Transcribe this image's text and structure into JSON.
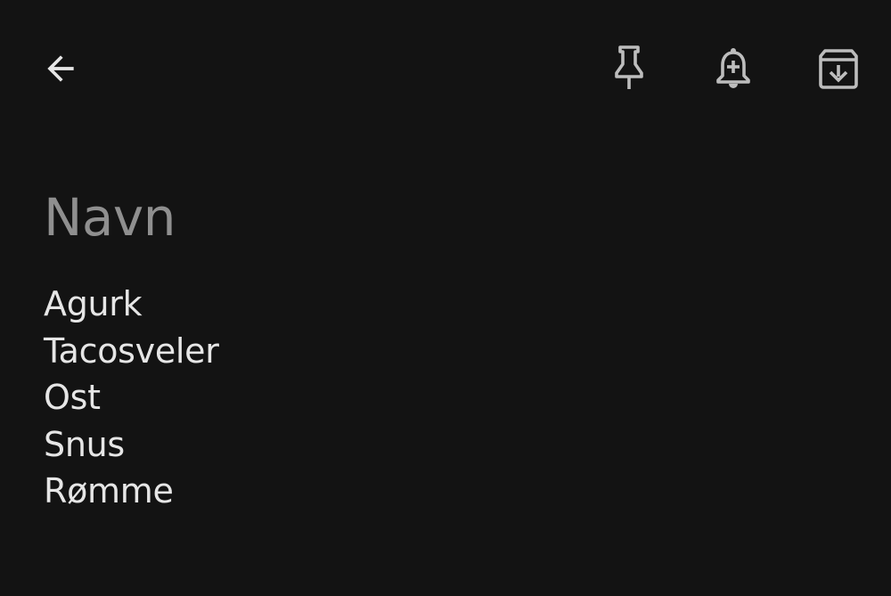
{
  "toolbar": {
    "back_icon": "arrow-left-icon",
    "pin_icon": "pin-icon",
    "reminder_icon": "bell-plus-icon",
    "archive_icon": "archive-icon",
    "icon_color": "#bdbdbd"
  },
  "note": {
    "title": "Navn",
    "lines": [
      "Agurk",
      "Tacosveler",
      "Ost",
      "Snus",
      "Rømme"
    ]
  },
  "colors": {
    "background": "#131313",
    "title": "#8f8f8f",
    "body_text": "#e6e6e6"
  }
}
